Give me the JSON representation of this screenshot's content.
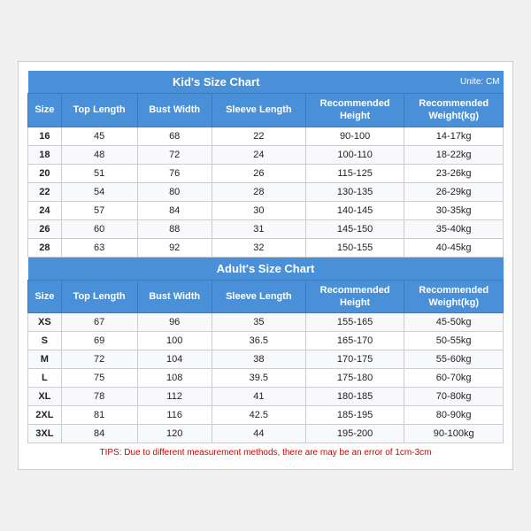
{
  "kids": {
    "section_title": "Kid's Size Chart",
    "unit": "Unite: CM",
    "headers": [
      "Size",
      "Top Length",
      "Bust Width",
      "Sleeve Length",
      "Recommended\nHeight",
      "Recommended\nWeight(kg)"
    ],
    "rows": [
      [
        "16",
        "45",
        "68",
        "22",
        "90-100",
        "14-17kg"
      ],
      [
        "18",
        "48",
        "72",
        "24",
        "100-110",
        "18-22kg"
      ],
      [
        "20",
        "51",
        "76",
        "26",
        "115-125",
        "23-26kg"
      ],
      [
        "22",
        "54",
        "80",
        "28",
        "130-135",
        "26-29kg"
      ],
      [
        "24",
        "57",
        "84",
        "30",
        "140-145",
        "30-35kg"
      ],
      [
        "26",
        "60",
        "88",
        "31",
        "145-150",
        "35-40kg"
      ],
      [
        "28",
        "63",
        "92",
        "32",
        "150-155",
        "40-45kg"
      ]
    ]
  },
  "adults": {
    "section_title": "Adult's Size Chart",
    "headers": [
      "Size",
      "Top Length",
      "Bust Width",
      "Sleeve Length",
      "Recommended\nHeight",
      "Recommended\nWeight(kg)"
    ],
    "rows": [
      [
        "XS",
        "67",
        "96",
        "35",
        "155-165",
        "45-50kg"
      ],
      [
        "S",
        "69",
        "100",
        "36.5",
        "165-170",
        "50-55kg"
      ],
      [
        "M",
        "72",
        "104",
        "38",
        "170-175",
        "55-60kg"
      ],
      [
        "L",
        "75",
        "108",
        "39.5",
        "175-180",
        "60-70kg"
      ],
      [
        "XL",
        "78",
        "112",
        "41",
        "180-185",
        "70-80kg"
      ],
      [
        "2XL",
        "81",
        "116",
        "42.5",
        "185-195",
        "80-90kg"
      ],
      [
        "3XL",
        "84",
        "120",
        "44",
        "195-200",
        "90-100kg"
      ]
    ]
  },
  "tips": "TIPS: Due to different measurement methods, there are may be an error of 1cm-3cm"
}
